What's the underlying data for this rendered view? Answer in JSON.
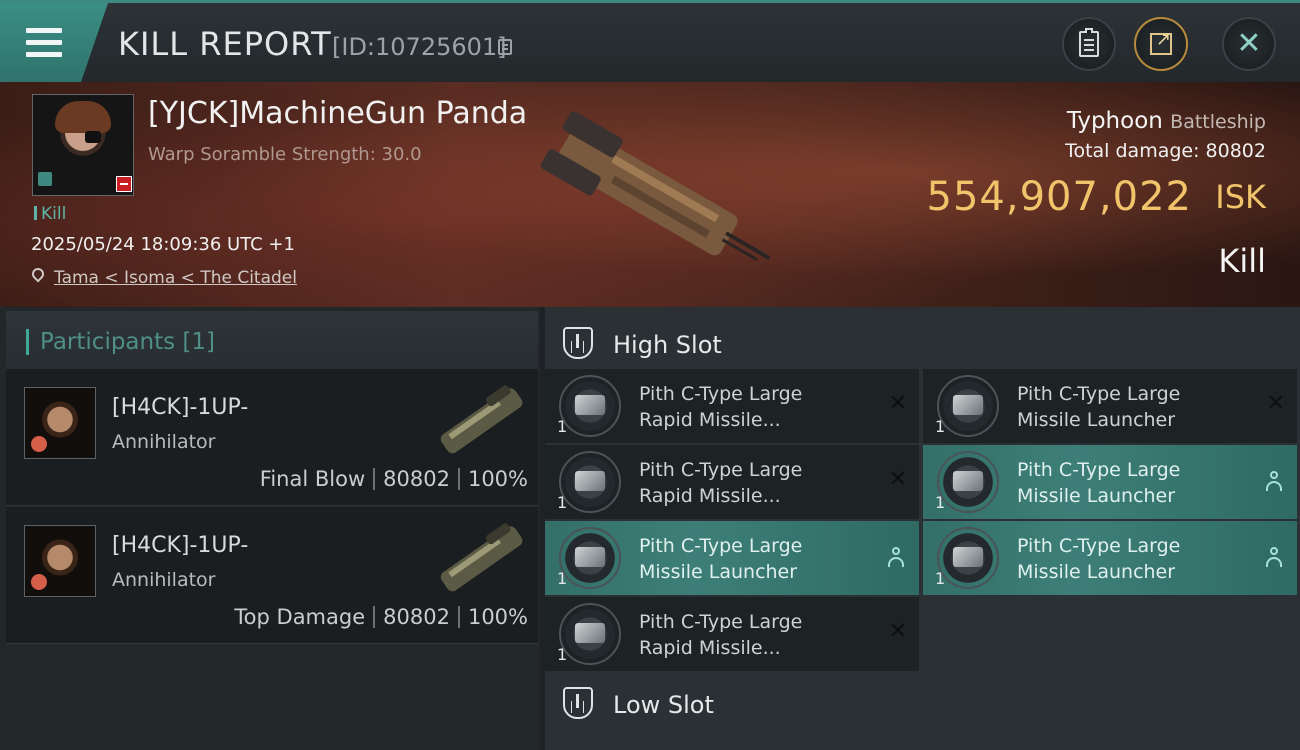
{
  "header": {
    "title": "KILL REPORT",
    "report_id": "[ID:10725601]",
    "icons": [
      "menu-icon",
      "copy-icon",
      "clipboard-icon",
      "share-icon",
      "close-icon"
    ]
  },
  "victim": {
    "name": "[YJCK]MachineGun Panda",
    "warp_scramble": "Warp Soramble Strength: 30.0",
    "kill_tag": "Kill",
    "datetime": "2025/05/24 18:09:36 UTC +1",
    "location": "Tama < Isoma < The Citadel",
    "ship_name": "Typhoon",
    "ship_class": "Battleship",
    "total_damage_label": "Total damage:",
    "total_damage_value": "80802",
    "isk_value": "554,907,022",
    "isk_unit": "ISK",
    "result": "Kill"
  },
  "participants": {
    "title": "Participants",
    "count": "[1]",
    "rows": [
      {
        "name": "[H4CK]-1UP-",
        "ship": "Annihilator",
        "role": "Final Blow",
        "damage": "80802",
        "percent": "100%"
      },
      {
        "name": "[H4CK]-1UP-",
        "ship": "Annihilator",
        "role": "Top Damage",
        "damage": "80802",
        "percent": "100%"
      }
    ]
  },
  "slots": {
    "high": {
      "title": "High Slot",
      "modules": [
        {
          "name_line1": "Pith C-Type Large",
          "name_line2": "Rapid Missile...",
          "qty": "1",
          "state": "destroyed"
        },
        {
          "name_line1": "Pith C-Type Large",
          "name_line2": "Missile Launcher",
          "qty": "1",
          "state": "destroyed"
        },
        {
          "name_line1": "Pith C-Type Large",
          "name_line2": "Rapid Missile...",
          "qty": "1",
          "state": "destroyed"
        },
        {
          "name_line1": "Pith C-Type Large",
          "name_line2": "Missile Launcher",
          "qty": "1",
          "state": "dropped"
        },
        {
          "name_line1": "Pith C-Type Large",
          "name_line2": "Missile Launcher",
          "qty": "1",
          "state": "dropped"
        },
        {
          "name_line1": "Pith C-Type Large",
          "name_line2": "Missile Launcher",
          "qty": "1",
          "state": "dropped"
        },
        {
          "name_line1": "Pith C-Type Large",
          "name_line2": "Rapid Missile...",
          "qty": "1",
          "state": "destroyed"
        }
      ]
    },
    "low": {
      "title": "Low Slot"
    }
  },
  "colors": {
    "accent": "#3fa89a",
    "isk_gold": "#f1c46b",
    "active_module": "#3d7f78",
    "alert_red": "#c81d25"
  }
}
